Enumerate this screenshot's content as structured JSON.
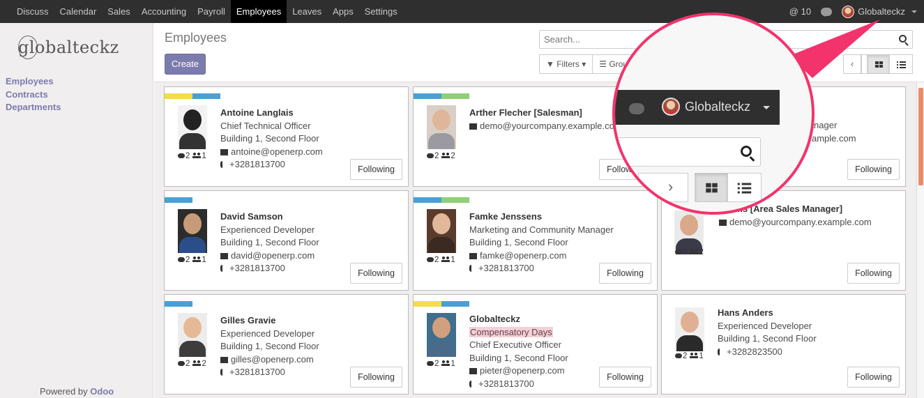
{
  "topbar": {
    "menu": [
      "Discuss",
      "Calendar",
      "Sales",
      "Accounting",
      "Payroll",
      "Employees",
      "Leaves",
      "Apps",
      "Settings"
    ],
    "active": "Employees",
    "notifications": "@ 10",
    "user": "Globalteckz"
  },
  "sidebar": {
    "logo": "globalteckz",
    "links": [
      "Employees",
      "Contracts",
      "Departments"
    ],
    "powered_prefix": "Powered by",
    "powered_brand": "Odoo"
  },
  "control": {
    "title": "Employees",
    "create": "Create",
    "search_placeholder": "Search...",
    "filters": "Filters",
    "group_by": "Group By"
  },
  "employees": [
    {
      "name": "Antoine Langlais",
      "lines": [
        "Chief Technical Officer",
        "Building 1, Second Floor"
      ],
      "email": "antoine@openerp.com",
      "phone": "+3281813700",
      "messages": "2",
      "followers": "1",
      "follow": "Following",
      "tags": [
        "#f4dc4b",
        "#4a9fd5"
      ],
      "photo": [
        "#f2f2f2",
        "#222",
        "#333"
      ]
    },
    {
      "name": "Arther Flecher [Salesman]",
      "lines": [],
      "email": "demo@yourcompany.example.com",
      "phone": "",
      "messages": "2",
      "followers": "2",
      "follow": "Following",
      "tags": [
        "#4a9fd5",
        "#8fcf77"
      ],
      "photo": [
        "#d9cfc5",
        "#e0b69a",
        "#9a9aa0"
      ]
    },
    {
      "name": "",
      "lines": [
        "Manager"
      ],
      "email": "ample.com",
      "phone": "",
      "messages": "",
      "followers": "",
      "follow": "Following",
      "tags": [],
      "photo": []
    },
    {
      "name": "David Samson",
      "lines": [
        "Experienced Developer",
        "Building 1, Second Floor"
      ],
      "email": "david@openerp.com",
      "phone": "+3281813700",
      "messages": "2",
      "followers": "1",
      "follow": "Following",
      "tags": [
        "#4a9fd5"
      ],
      "photo": [
        "#2c2c2c",
        "#c79a78",
        "#2b4e8a"
      ]
    },
    {
      "name": "Famke Jenssens",
      "lines": [
        "Marketing and Community Manager",
        "Building 1, Second Floor"
      ],
      "email": "famke@openerp.com",
      "phone": "+3281813700",
      "messages": "2",
      "followers": "1",
      "follow": "Following",
      "tags": [
        "#4a9fd5",
        "#8fcf77"
      ],
      "photo": [
        "#5a3b2c",
        "#e2b89a",
        "#3a2a22"
      ]
    },
    {
      "name": "tevens [Area Sales Manager]",
      "lines": [],
      "email": "demo@yourcompany.example.com",
      "phone": "",
      "messages": "2",
      "followers": "2",
      "follow": "Following",
      "tags": [],
      "photo": [
        "#eaeaea",
        "#d9a98a",
        "#3a3a4a"
      ]
    },
    {
      "name": "Gilles Gravie",
      "lines": [
        "Experienced Developer",
        "Building 1, Second Floor"
      ],
      "email": "gilles@openerp.com",
      "phone": "+3281813700",
      "messages": "2",
      "followers": "2",
      "follow": "Following",
      "tags": [
        "#4a9fd5"
      ],
      "photo": [
        "#ececec",
        "#e6b996",
        "#3d3d3d"
      ]
    },
    {
      "name": "Globalteckz",
      "highlight": "Compensatory Days",
      "lines": [
        "Chief Executive Officer",
        "Building 1, Second Floor"
      ],
      "email": "pieter@openerp.com",
      "phone": "+3281813700",
      "messages": "2",
      "followers": "1",
      "follow": "Following",
      "tags": [
        "#f4dc4b",
        "#4a9fd5"
      ],
      "photo": [
        "#3e6f8c",
        "#d1a07e",
        "#4a6a8a"
      ]
    },
    {
      "name": "Hans Anders",
      "lines": [
        "Experienced Developer",
        "Building 1, Second Floor"
      ],
      "email": "",
      "phone": "+3282823500",
      "messages": "2",
      "followers": "1",
      "follow": "Following",
      "tags": [],
      "photo": [
        "#efefef",
        "#e0b094",
        "#2a2a2a"
      ]
    }
  ],
  "magnifier": {
    "user": "Globalteckz",
    "border_color": "#f2336c"
  },
  "colors": {
    "accent": "#7c7bad",
    "topbar": "#2f2f2f",
    "highlight": "#f2336c"
  }
}
